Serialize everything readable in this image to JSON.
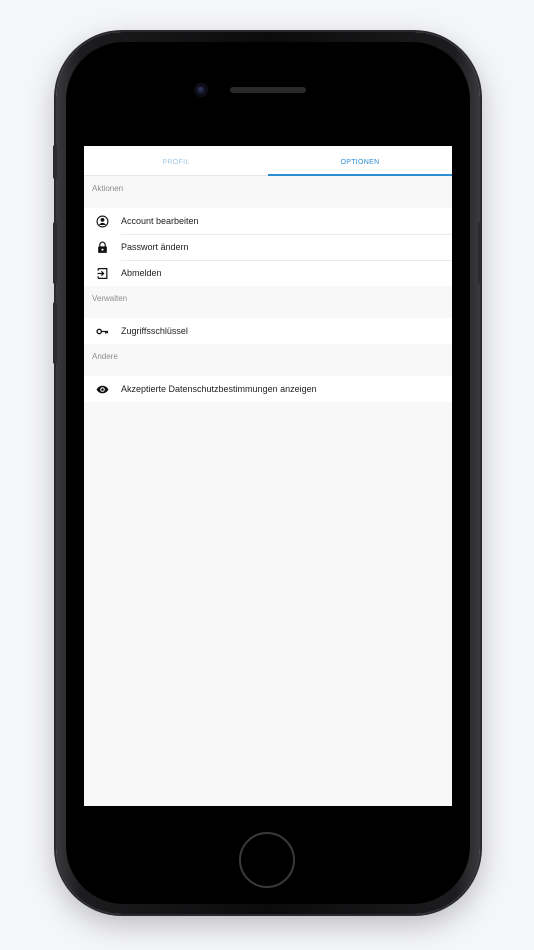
{
  "tabs": [
    {
      "label": "PROFIL",
      "active": false
    },
    {
      "label": "OPTIONEN",
      "active": true
    }
  ],
  "accent_color": "#2c8fd1",
  "sections": [
    {
      "title": "Aktionen",
      "items": [
        {
          "label": "Account bearbeiten",
          "icon": "account-circle-icon"
        },
        {
          "label": "Passwort ändern",
          "icon": "lock-icon"
        },
        {
          "label": "Abmelden",
          "icon": "logout-icon"
        }
      ]
    },
    {
      "title": "Verwalten",
      "items": [
        {
          "label": "Zugriffsschlüssel",
          "icon": "key-icon"
        }
      ]
    },
    {
      "title": "Andere",
      "items": [
        {
          "label": "Akzeptierte Datenschutzbestimmungen anzeigen",
          "icon": "eye-icon"
        }
      ]
    }
  ]
}
